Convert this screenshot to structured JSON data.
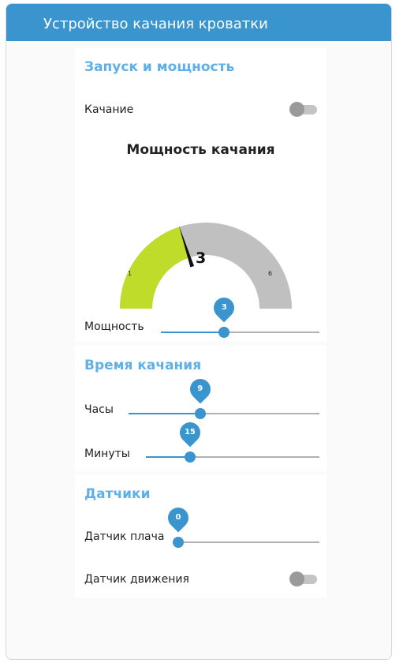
{
  "header": {
    "title": "Устройство качания кроватки"
  },
  "sections": {
    "launch": {
      "title": "Запуск и мощность",
      "swing_label": "Качание",
      "swing_on": false,
      "gauge": {
        "title": "Мощность качания",
        "value": 3,
        "value_text": "3",
        "min": 1,
        "max": 6,
        "min_label": "1",
        "max_label": "6",
        "fill_color": "#c0dc2b",
        "track_color": "#c0c0c0"
      },
      "power": {
        "label": "Мощность",
        "value": 3,
        "value_text": "3",
        "min": 1,
        "max": 6
      }
    },
    "time": {
      "title": "Время качания",
      "hours": {
        "label": "Часы",
        "value": 9,
        "value_text": "9",
        "min": 0,
        "max": 24
      },
      "minutes": {
        "label": "Минуты",
        "value": 15,
        "value_text": "15",
        "min": 0,
        "max": 59
      }
    },
    "sensors": {
      "title": "Датчики",
      "cry": {
        "label": "Датчик плача",
        "value": 0,
        "value_text": "0",
        "min": 0,
        "max": 100
      },
      "motion_label": "Датчик движения",
      "motion_on": false
    }
  },
  "colors": {
    "accent": "#3a95cf",
    "title": "#5fb0e8",
    "header_text": "#ffffff"
  }
}
